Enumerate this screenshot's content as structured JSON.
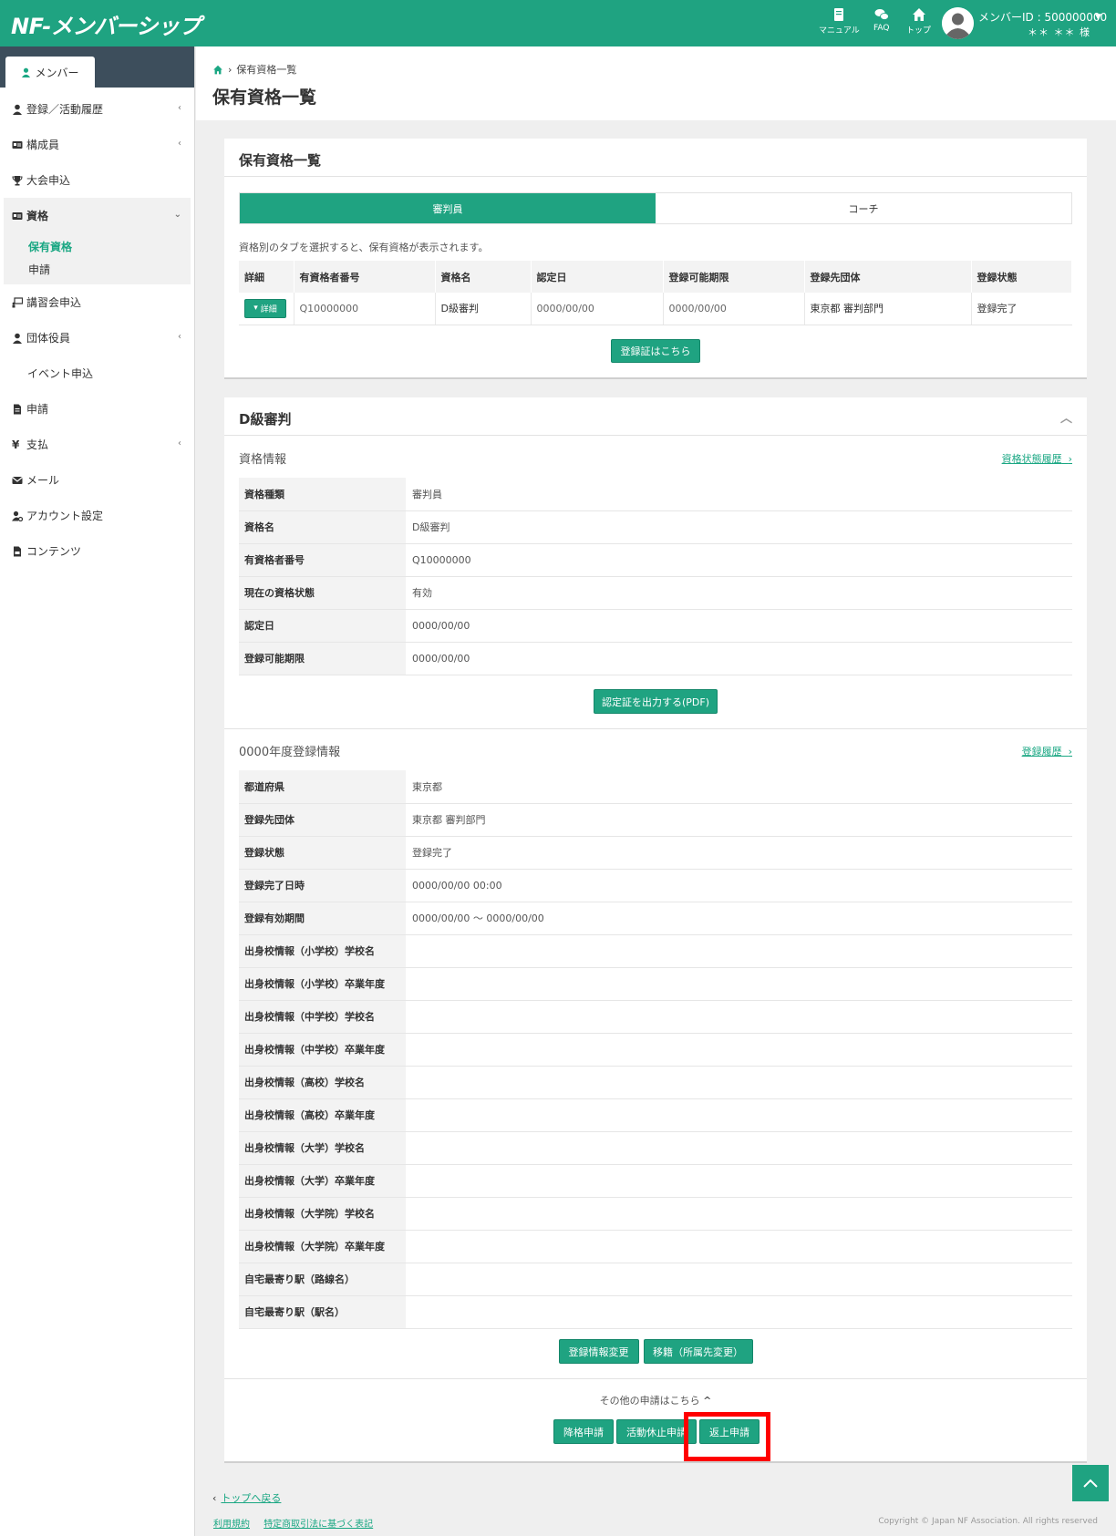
{
  "header": {
    "logo": "NF-メンバーシップ",
    "nav": [
      {
        "label": "マニュアル",
        "icon": "book-icon"
      },
      {
        "label": "FAQ",
        "icon": "chat-icon"
      },
      {
        "label": "トップ",
        "icon": "home-icon"
      }
    ],
    "member_id": "メンバーID : 500000000",
    "member_name": "＊＊ ＊＊ 様"
  },
  "sidebar": {
    "tab": "メンバー",
    "items": [
      {
        "label": "登録／活動履歴",
        "icon": "user-icon",
        "chevron": "‹"
      },
      {
        "label": "構成員",
        "icon": "id-card-icon",
        "chevron": "‹"
      },
      {
        "label": "大会申込",
        "icon": "trophy-icon",
        "chevron": ""
      },
      {
        "label": "資格",
        "icon": "id-card-icon",
        "chevron": "⌄"
      },
      {
        "label": "講習会申込",
        "icon": "presentation-icon",
        "chevron": ""
      },
      {
        "label": "団体役員",
        "icon": "user-icon",
        "chevron": "‹"
      },
      {
        "label": "イベント申込",
        "icon": "",
        "chevron": ""
      },
      {
        "label": "申請",
        "icon": "file-icon",
        "chevron": ""
      },
      {
        "label": "支払",
        "icon": "yen-icon",
        "chevron": "‹"
      },
      {
        "label": "メール",
        "icon": "mail-icon",
        "chevron": ""
      },
      {
        "label": "アカウント設定",
        "icon": "user-cog-icon",
        "chevron": ""
      },
      {
        "label": "コンテンツ",
        "icon": "document-icon",
        "chevron": ""
      }
    ],
    "sub_items": [
      "保有資格",
      "申請"
    ]
  },
  "breadcrumb": {
    "current": "保有資格一覧"
  },
  "page_title": "保有資格一覧",
  "list_card": {
    "title": "保有資格一覧",
    "tabs": [
      "審判員",
      "コーチ"
    ],
    "note": "資格別のタブを選択すると、保有資格が表示されます。",
    "columns": [
      "詳細",
      "有資格者番号",
      "資格名",
      "認定日",
      "登録可能期限",
      "登録先団体",
      "登録状態"
    ],
    "row": {
      "detail_btn": "詳細",
      "number": "Q10000000",
      "name": "D級審判",
      "date": "0000/00/00",
      "limit": "0000/00/00",
      "org": "東京都 審判部門",
      "status": "登録完了"
    },
    "register_btn": "登録証はこちら"
  },
  "detail_card": {
    "title": "D級審判",
    "qual_info": {
      "heading": "資格情報",
      "link": "資格状態履歴",
      "rows": [
        {
          "k": "資格種類",
          "v": "審判員"
        },
        {
          "k": "資格名",
          "v": "D級審判"
        },
        {
          "k": "有資格者番号",
          "v": "Q10000000"
        },
        {
          "k": "現在の資格状態",
          "v": "有効"
        },
        {
          "k": "認定日",
          "v": "0000/00/00"
        },
        {
          "k": "登録可能期限",
          "v": "0000/00/00"
        }
      ],
      "pdf_btn": "認定証を出力する(PDF)"
    },
    "reg_info": {
      "heading": "0000年度登録情報",
      "link": "登録履歴",
      "rows": [
        {
          "k": "都道府県",
          "v": "東京都"
        },
        {
          "k": "登録先団体",
          "v": "東京都 審判部門"
        },
        {
          "k": "登録状態",
          "v": "登録完了"
        },
        {
          "k": "登録完了日時",
          "v": "0000/00/00 00:00"
        },
        {
          "k": "登録有効期間",
          "v": "0000/00/00 ～ 0000/00/00"
        },
        {
          "k": "出身校情報（小学校）学校名",
          "v": ""
        },
        {
          "k": "出身校情報（小学校）卒業年度",
          "v": ""
        },
        {
          "k": "出身校情報（中学校）学校名",
          "v": ""
        },
        {
          "k": "出身校情報（中学校）卒業年度",
          "v": ""
        },
        {
          "k": "出身校情報（高校）学校名",
          "v": ""
        },
        {
          "k": "出身校情報（高校）卒業年度",
          "v": ""
        },
        {
          "k": "出身校情報（大学）学校名",
          "v": ""
        },
        {
          "k": "出身校情報（大学）卒業年度",
          "v": ""
        },
        {
          "k": "出身校情報（大学院）学校名",
          "v": ""
        },
        {
          "k": "出身校情報（大学院）卒業年度",
          "v": ""
        },
        {
          "k": "自宅最寄り駅（路線名）",
          "v": ""
        },
        {
          "k": "自宅最寄り駅（駅名）",
          "v": ""
        }
      ],
      "buttons": [
        "登録情報変更",
        "移籍（所属先変更）"
      ]
    },
    "other": {
      "label": "その他の申請はこちら",
      "buttons": [
        "降格申請",
        "活動休止申請",
        "返上申請"
      ]
    }
  },
  "footer": {
    "back": "トップへ戻る",
    "links": [
      "利用規約",
      "特定商取引法に基づく表記"
    ],
    "copyright": "Copyright © Japan NF Association. All rights reserved"
  },
  "colors": {
    "accent": "#1fa381",
    "sidebar_dark": "#3d4e5c",
    "highlight": "#ff0000"
  }
}
